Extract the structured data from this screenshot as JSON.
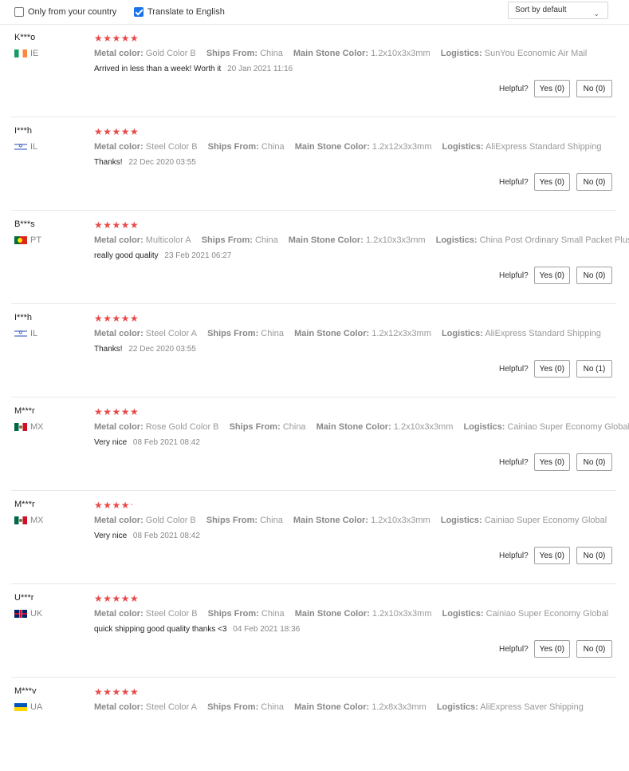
{
  "filters": {
    "only_country_label": "Only from your country",
    "only_country_checked": false,
    "translate_label": "Translate to English",
    "translate_checked": true,
    "sort_value": "Sort by default"
  },
  "labels": {
    "metal_color": "Metal color:",
    "ships_from": "Ships From:",
    "main_stone_color": "Main Stone Color:",
    "logistics": "Logistics:",
    "helpful": "Helpful?"
  },
  "reviews": [
    {
      "name": "K***o",
      "country": "IE",
      "flag": "ie",
      "rating": 5,
      "stars": "★★★★★",
      "metal_color": "Gold Color B",
      "ships_from": "China",
      "main_stone_color": "1.2x10x3x3mm",
      "logistics": "SunYou Economic Air Mail",
      "text": "Arrived in less than a week! Worth it",
      "date": "20 Jan 2021 11:16",
      "yes": "Yes (0)",
      "no": "No (0)"
    },
    {
      "name": "I***h",
      "country": "IL",
      "flag": "il",
      "rating": 5,
      "stars": "★★★★★",
      "metal_color": "Steel Color B",
      "ships_from": "China",
      "main_stone_color": "1.2x12x3x3mm",
      "logistics": "AliExpress Standard Shipping",
      "text": "Thanks!",
      "date": "22 Dec 2020 03:55",
      "yes": "Yes (0)",
      "no": "No (0)"
    },
    {
      "name": "B***s",
      "country": "PT",
      "flag": "pt",
      "rating": 5,
      "stars": "★★★★★",
      "metal_color": "Multicolor A",
      "ships_from": "China",
      "main_stone_color": "1.2x10x3x3mm",
      "logistics": "China Post Ordinary Small Packet Plus",
      "text": "really good quality",
      "date": "23 Feb 2021 06:27",
      "yes": "Yes (0)",
      "no": "No (0)"
    },
    {
      "name": "I***h",
      "country": "IL",
      "flag": "il",
      "rating": 5,
      "stars": "★★★★★",
      "metal_color": "Steel Color A",
      "ships_from": "China",
      "main_stone_color": "1.2x12x3x3mm",
      "logistics": "AliExpress Standard Shipping",
      "text": "Thanks!",
      "date": "22 Dec 2020 03:55",
      "yes": "Yes (0)",
      "no": "No (1)"
    },
    {
      "name": "M***r",
      "country": "MX",
      "flag": "mx",
      "rating": 5,
      "stars": "★★★★★",
      "metal_color": "Rose Gold Color B",
      "ships_from": "China",
      "main_stone_color": "1.2x10x3x3mm",
      "logistics": "Cainiao Super Economy Global",
      "text": "Very nice",
      "date": "08 Feb 2021 08:42",
      "yes": "Yes (0)",
      "no": "No (0)"
    },
    {
      "name": "M***r",
      "country": "MX",
      "flag": "mx",
      "rating": 4.5,
      "stars": "★★★★★",
      "metal_color": "Gold Color B",
      "ships_from": "China",
      "main_stone_color": "1.2x10x3x3mm",
      "logistics": "Cainiao Super Economy Global",
      "text": "Very nice",
      "date": "08 Feb 2021 08:42",
      "yes": "Yes (0)",
      "no": "No (0)"
    },
    {
      "name": "U***r",
      "country": "UK",
      "flag": "uk",
      "rating": 5,
      "stars": "★★★★★",
      "metal_color": "Steel Color B",
      "ships_from": "China",
      "main_stone_color": "1.2x10x3x3mm",
      "logistics": "Cainiao Super Economy Global",
      "text": "quick shipping good quality thanks <3",
      "date": "04 Feb 2021 18:36",
      "yes": "Yes (0)",
      "no": "No (0)"
    },
    {
      "name": "M***v",
      "country": "UA",
      "flag": "ua",
      "rating": 5,
      "stars": "★★★★★",
      "metal_color": "Steel Color A",
      "ships_from": "China",
      "main_stone_color": "1.2x8x3x3mm",
      "logistics": "AliExpress Saver Shipping",
      "text": "",
      "date": "",
      "yes": "",
      "no": ""
    }
  ],
  "colors": {
    "star": "#e84a4a",
    "checkbox_on": "#1a73e8"
  }
}
